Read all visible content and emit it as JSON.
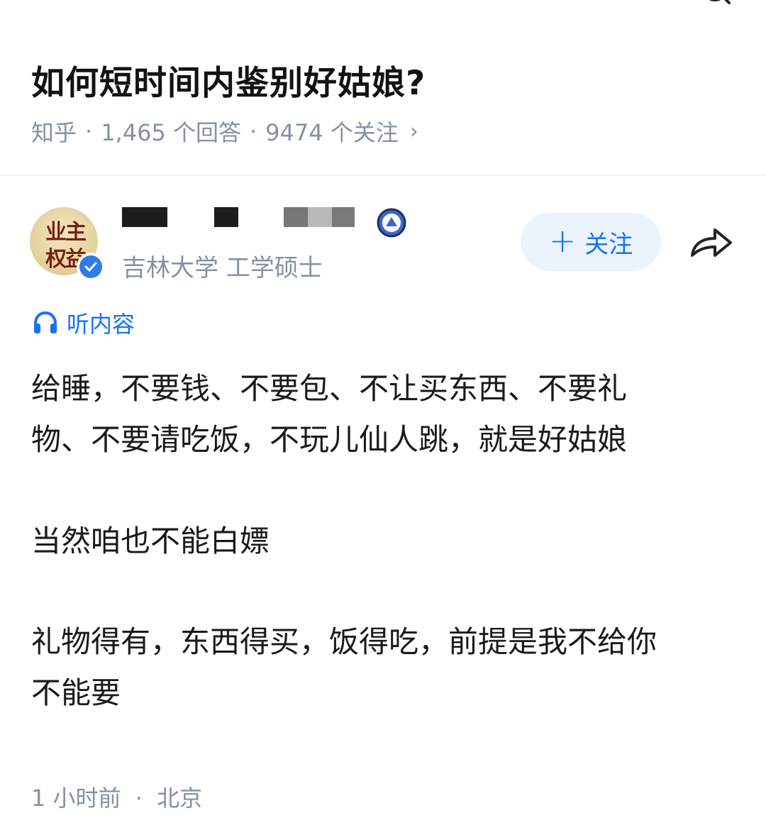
{
  "question": {
    "title": "如何短时间内鉴别好姑娘?",
    "source": "知乎",
    "separator": "·",
    "answers": "1,465 个回答",
    "followers": "9474 个关注",
    "chevron": "›"
  },
  "author": {
    "avatar_text_line1": "业主",
    "avatar_text_line2": "权益",
    "bio": "吉林大学 工学硕士",
    "follow_label": "关注",
    "follow_plus": "+"
  },
  "listen_label": "听内容",
  "answer": {
    "line1": "给睡，不要钱、不要包、不让买东西、不要礼",
    "line2": "物、不要请吃饭，不玩儿仙人跳，就是好姑娘",
    "line3": "当然咱也不能白嫖",
    "line4": "礼物得有，东西得买，饭得吃，前提是我不给你",
    "line5": "不能要"
  },
  "footer": {
    "time": "1 小时前",
    "separator": "·",
    "location": "北京"
  },
  "colors": {
    "accent": "#1772f6",
    "meta_gray": "#8590a6",
    "follow_bg": "#ebf3fd",
    "verify_blue": "#2f7bea"
  }
}
